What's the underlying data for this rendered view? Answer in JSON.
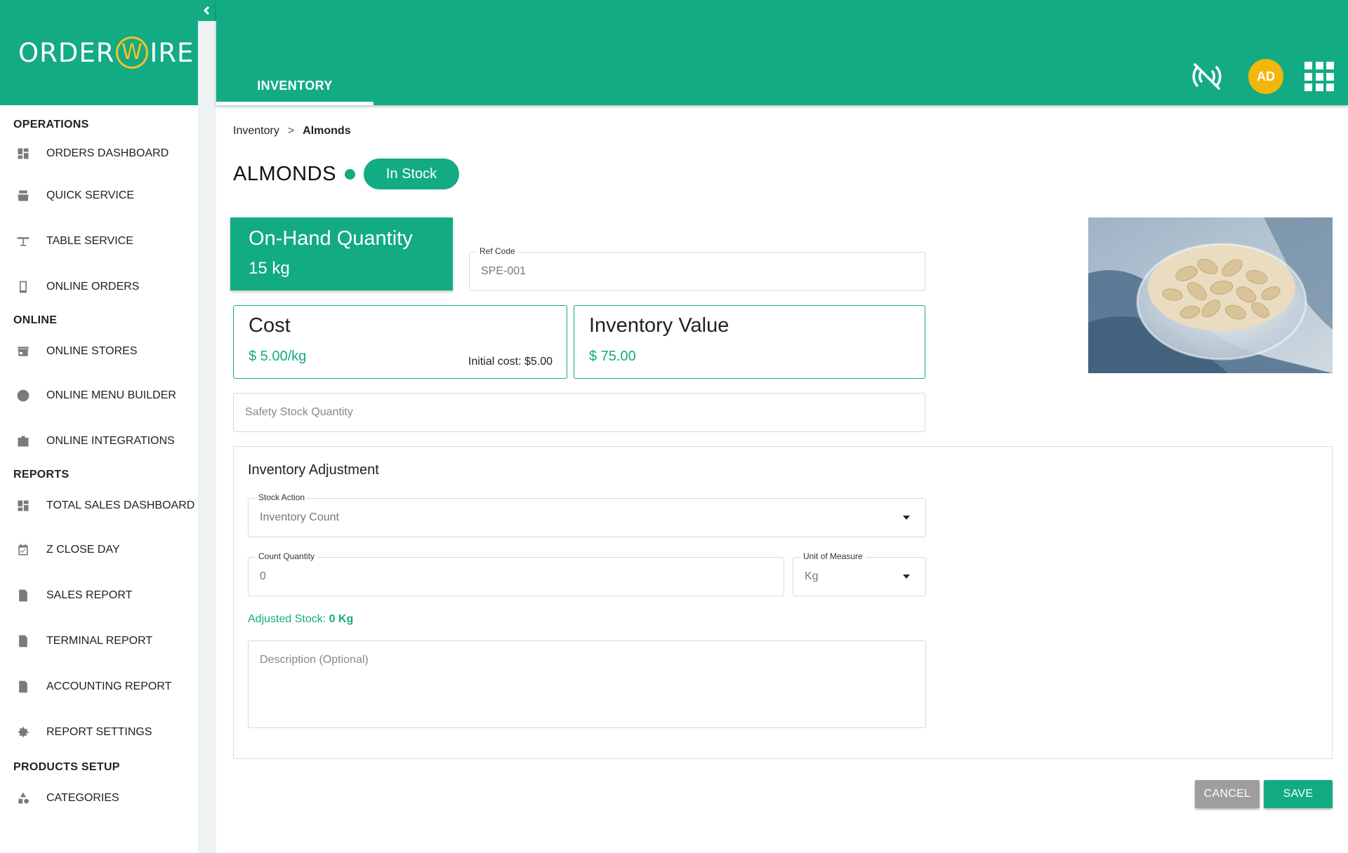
{
  "brand": {
    "left": "ORDER",
    "mid": "W",
    "right": "IRE"
  },
  "header": {
    "active_tab": "INVENTORY",
    "avatar_initials": "AD"
  },
  "sidebar": {
    "sections": [
      {
        "title": "OPERATIONS",
        "items": [
          {
            "label": "ORDERS DASHBOARD",
            "icon": "dashboard-icon"
          },
          {
            "label": "QUICK SERVICE",
            "icon": "register-icon"
          },
          {
            "label": "TABLE SERVICE",
            "icon": "table-icon"
          },
          {
            "label": "ONLINE ORDERS",
            "icon": "tablet-icon"
          }
        ]
      },
      {
        "title": "ONLINE",
        "items": [
          {
            "label": "ONLINE STORES",
            "icon": "store-icon"
          },
          {
            "label": "ONLINE MENU BUILDER",
            "icon": "menu-builder-icon"
          },
          {
            "label": "ONLINE INTEGRATIONS",
            "icon": "integrations-icon"
          }
        ]
      },
      {
        "title": "REPORTS",
        "items": [
          {
            "label": "TOTAL SALES DASHBOARD",
            "icon": "dashboard-icon"
          },
          {
            "label": "Z CLOSE DAY",
            "icon": "calendar-check-icon"
          },
          {
            "label": "SALES REPORT",
            "icon": "report-icon"
          },
          {
            "label": "TERMINAL REPORT",
            "icon": "report-icon"
          },
          {
            "label": "ACCOUNTING REPORT",
            "icon": "report-icon"
          },
          {
            "label": "REPORT SETTINGS",
            "icon": "gear-icon"
          }
        ]
      },
      {
        "title": "PRODUCTS SETUP",
        "items": [
          {
            "label": "CATEGORIES",
            "icon": "categories-icon"
          }
        ]
      }
    ]
  },
  "breadcrumb": {
    "parent": "Inventory",
    "separator": ">",
    "current": "Almonds"
  },
  "product": {
    "name": "ALMONDS",
    "status": "In Stock"
  },
  "on_hand": {
    "title": "On-Hand Quantity",
    "value": "15 kg"
  },
  "ref_code": {
    "label": "Ref Code",
    "value": "SPE-001"
  },
  "cost": {
    "title": "Cost",
    "value": "$ 5.00/kg",
    "initial": "Initial cost: $5.00"
  },
  "inventory_value": {
    "title": "Inventory Value",
    "value": "$ 75.00"
  },
  "safety_stock": {
    "placeholder": "Safety Stock Quantity"
  },
  "adjustment": {
    "title": "Inventory Adjustment",
    "stock_action": {
      "label": "Stock Action",
      "value": "Inventory Count"
    },
    "count_quantity": {
      "label": "Count Quantity",
      "value": "0"
    },
    "unit": {
      "label": "Unit of Measure",
      "value": "Kg"
    },
    "adjusted_label": "Adjusted Stock:",
    "adjusted_value": "0 Kg",
    "description_placeholder": "Description (Optional)"
  },
  "actions": {
    "cancel": "CANCEL",
    "save": "SAVE"
  },
  "colors": {
    "primary": "#13ab84",
    "avatar": "#f4b60b",
    "cancel": "#9e9e9e"
  }
}
